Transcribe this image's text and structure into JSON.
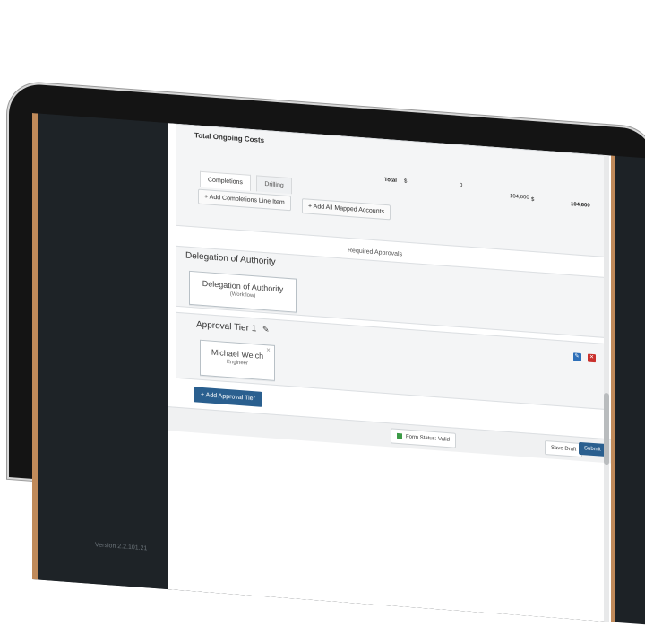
{
  "top_section": {
    "title": "Total Ongoing Costs",
    "tabs": [
      "Completions",
      "Drilling"
    ],
    "totals": {
      "label": "Total",
      "currency": "$",
      "values": [
        "0",
        "104,600",
        "104,600"
      ]
    },
    "buttons": [
      "+ Add Completions Line Item",
      "+ Add All Mapped Accounts"
    ]
  },
  "approvals": {
    "section_label": "Required Approvals",
    "delegation": {
      "header": "Delegation of Authority",
      "card_title": "Delegation of Authority",
      "card_sub": "(Workflow)"
    },
    "tier": {
      "header": "Approval Tier 1",
      "approver_name": "Michael Welch",
      "approver_role": "Engineer"
    },
    "add_tier_label": "+ Add Approval Tier"
  },
  "footer": {
    "form_status": "Form Status: Valid",
    "save_draft": "Save Draft",
    "submit": "Submit"
  },
  "sidebar": {
    "version": "Version 2.2.101.21"
  },
  "colors": {
    "primary": "#2a5f8f",
    "edit_icon": "#2d6fb8",
    "delete_icon": "#c9302c",
    "valid": "#3c9a46"
  }
}
